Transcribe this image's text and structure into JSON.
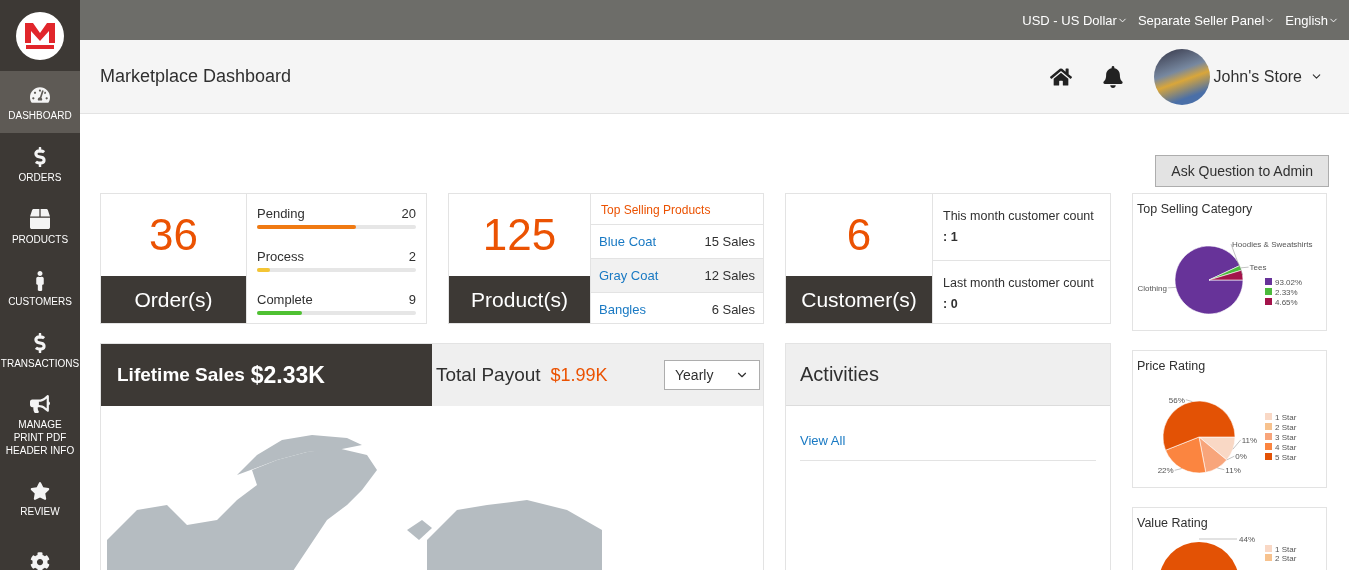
{
  "sidebar": {
    "items": [
      {
        "label": "DASHBOARD",
        "selected": true
      },
      {
        "label": "ORDERS",
        "selected": false
      },
      {
        "label": "PRODUCTS",
        "selected": false
      },
      {
        "label": "CUSTOMERS",
        "selected": false
      },
      {
        "label": "TRANSACTIONS",
        "selected": false
      },
      {
        "label": "MANAGE PRINT PDF HEADER INFO",
        "selected": false
      },
      {
        "label": "REVIEW",
        "selected": false
      },
      {
        "selected": false
      }
    ]
  },
  "top_bar": {
    "menus": [
      "USD - US Dollar",
      "Separate Seller Panel",
      "English"
    ]
  },
  "header": {
    "title": "Marketplace Dashboard",
    "store_name": "John's Store"
  },
  "ask_button": "Ask Question to Admin",
  "orders": {
    "count": "36",
    "label": "Order(s)",
    "statuses": [
      {
        "name": "Pending",
        "count": "20",
        "level": 0.62,
        "color": "#f07a12"
      },
      {
        "name": "Process",
        "count": "2",
        "level": 0.08,
        "color": "#f4c534"
      },
      {
        "name": "Complete",
        "count": "9",
        "level": 0.28,
        "color": "#4fc132"
      }
    ]
  },
  "products": {
    "count": "125",
    "label": "Product(s)",
    "top_title": "Top Selling Products",
    "items": [
      {
        "name": "Blue Coat",
        "sales": "15 Sales",
        "selected": false
      },
      {
        "name": "Gray Coat",
        "sales": "12 Sales",
        "selected": true
      },
      {
        "name": "Bangles",
        "sales": "6 Sales",
        "selected": false
      }
    ]
  },
  "customers": {
    "count": "6",
    "label": "Customer(s)",
    "rows": [
      {
        "text": "This month customer count",
        "value": ": 1"
      },
      {
        "text": "Last month customer count",
        "value": ": 0"
      }
    ]
  },
  "sales": {
    "lifetime_label": "Lifetime Sales",
    "lifetime_value": "$2.33K",
    "payout_label": "Total Payout",
    "payout_value": "$1.99K",
    "period": "Yearly"
  },
  "activities": {
    "title": "Activities",
    "link": "View All"
  },
  "charts": [
    {
      "title": "Top Selling Category",
      "legend_items": [
        {
          "label": "93.02%",
          "color": "#673399"
        },
        {
          "label": "2.33%",
          "color": "#4cba3c"
        },
        {
          "label": "4.65%",
          "color": "#a3134a"
        }
      ],
      "chart_data": {
        "type": "pie",
        "categories": [
          "Clothing",
          "Tees",
          "Hoodies & Sweatshirts"
        ],
        "values": [
          93.02,
          2.33,
          4.65
        ],
        "colors": [
          "#673399",
          "#4cba3c",
          "#a3134a"
        ]
      }
    },
    {
      "title": "Price Rating",
      "chart_data": {
        "type": "pie",
        "categories": [
          "1 Star",
          "2 Star",
          "3 Star",
          "4 Star",
          "5 Star"
        ],
        "values": [
          11,
          0,
          11,
          22,
          56
        ],
        "colors": [
          "#f9d8c5",
          "#f7c28e",
          "#f8a57b",
          "#fb8540",
          "#e35205"
        ],
        "value_labels": [
          "11%",
          "0%",
          "11%",
          "22%",
          "56%"
        ],
        "legend": "right"
      }
    }
  ],
  "value_rating": {
    "title": "Value Rating",
    "label": "44%",
    "legend": [
      {
        "label": "1 Star",
        "color": "#f9d8c5"
      },
      {
        "label": "2 Star",
        "color": "#f7c28e"
      }
    ]
  }
}
